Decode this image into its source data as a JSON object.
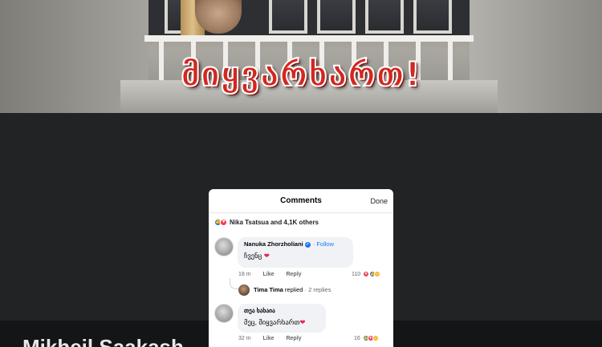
{
  "photo": {
    "slogan": "მიყვარხართ!"
  },
  "caption": {
    "text": "Mikheil Saakash"
  },
  "comments_sheet": {
    "title": "Comments",
    "done_label": "Done",
    "reactions_summary": "Nika Tsatsua and 4,1K others",
    "comments": [
      {
        "author": "Nanuka Zhorzholiani",
        "follow_label": "· Follow",
        "text": "ჩვენც",
        "time": "18 m",
        "like_label": "Like",
        "reply_label": "Reply",
        "reaction_count": "110",
        "reply_summary": {
          "author": "Tima Tima",
          "action": "replied",
          "count": "· 2 replies"
        }
      },
      {
        "author": "თეა ხახაია",
        "text": "მეც, მიყვარხართ",
        "time": "32 m",
        "like_label": "Like",
        "reply_label": "Reply",
        "reaction_count": "16"
      }
    ]
  },
  "icons": [
    "like-reaction-icon",
    "love-reaction-icon",
    "haha-reaction-icon",
    "verified-badge-icon",
    "heart-emoji-icon"
  ],
  "colors": {
    "accent_blue": "#1877f2",
    "love_red": "#f33e58",
    "slogan_red": "#d3271f"
  }
}
